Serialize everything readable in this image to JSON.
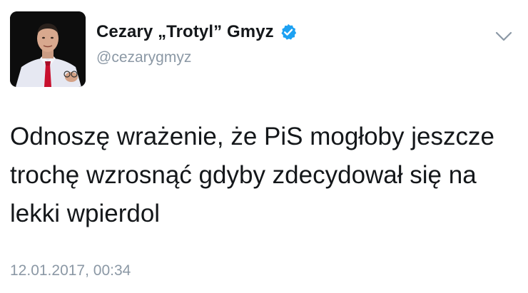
{
  "tweet": {
    "author": {
      "display_name": "Cezary „Trotyl” Gmyz",
      "handle": "@cezarygmyz",
      "verified": true,
      "avatar_icon": "user-avatar-photo"
    },
    "text": "Odnoszę wrażenie, że PiS mogłoby jeszcze trochę wzrosnąć gdyby zdecydował się na lekki wpierdol",
    "timestamp": "12.01.2017, 00:34",
    "menu_icon": "chevron-down-icon"
  },
  "colors": {
    "verified_badge": "#1da1f2",
    "secondary_text": "#8b98a5",
    "primary_text": "#14171a",
    "background": "#ffffff"
  }
}
